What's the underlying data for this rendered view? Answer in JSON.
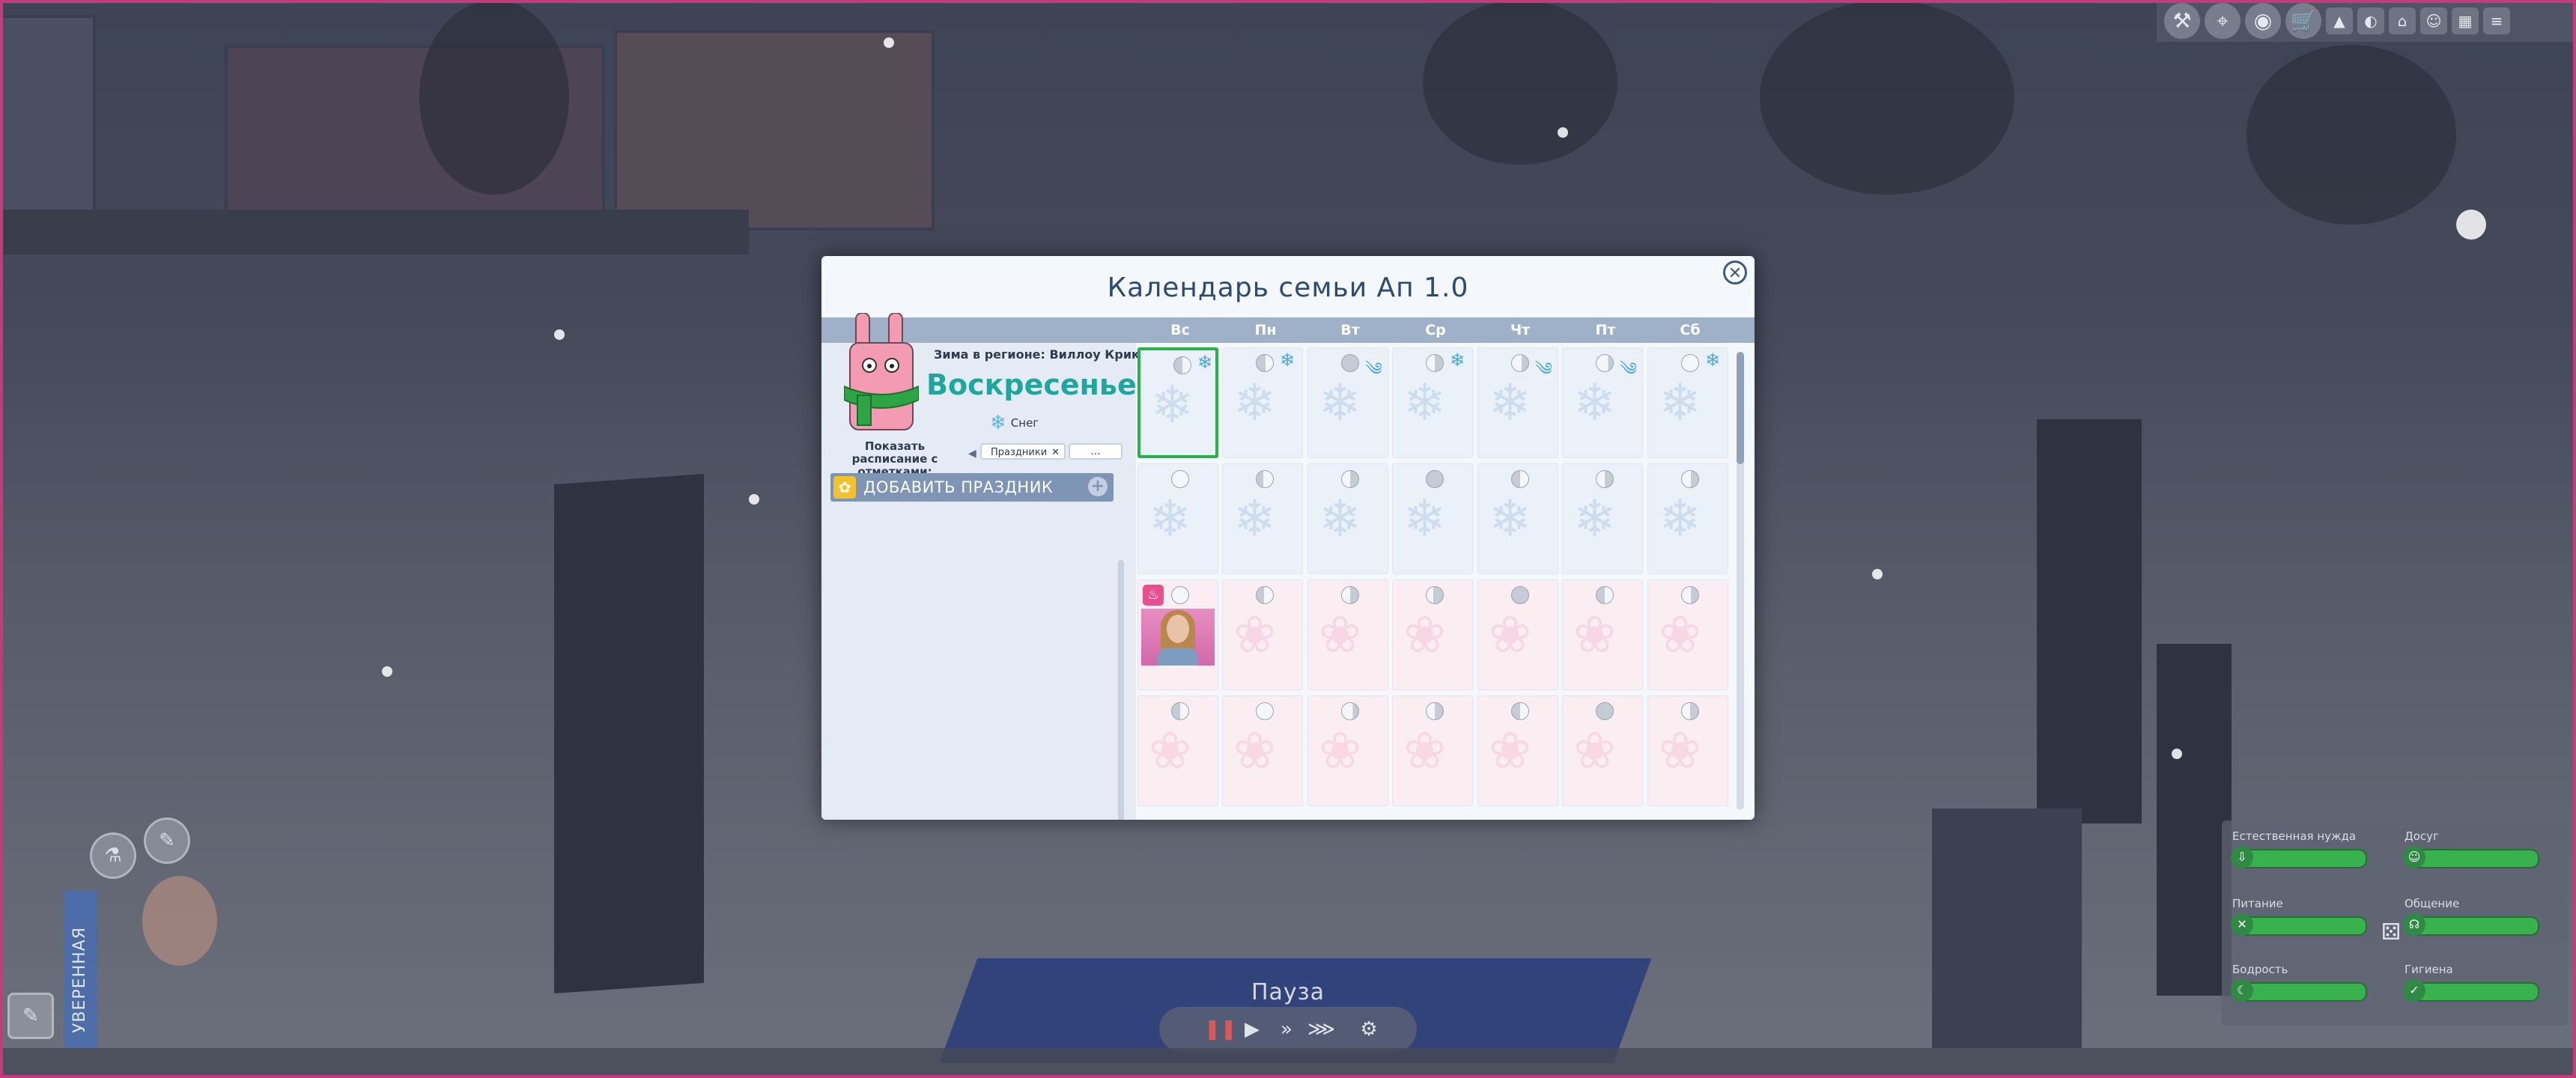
{
  "calendar": {
    "title": "Календарь семьи Ап 1.0",
    "day_headers": [
      "Вс",
      "Пн",
      "Вт",
      "Ср",
      "Чт",
      "Пт",
      "Сб"
    ],
    "season_region": "Зима в регионе: Виллоу Крик",
    "selected_day": "Воскресенье",
    "weather": "Снег",
    "filter_label": "Показать расписание с отметками:",
    "filter_value": "Праздники",
    "filter_more": "...",
    "add_holiday": "Добавить праздник"
  },
  "hud": {
    "pause": "Пауза",
    "mood": "УВЕРЕННАЯ",
    "needs": [
      "Естественная нужда",
      "Досуг",
      "Питание",
      "Общение",
      "Бодрость",
      "Гигиена"
    ]
  },
  "colors": {
    "accent_teal": "#1ea69f",
    "title_blue": "#2d4a73",
    "today_outline": "#27b24a",
    "need_bar": "#37b24d"
  }
}
